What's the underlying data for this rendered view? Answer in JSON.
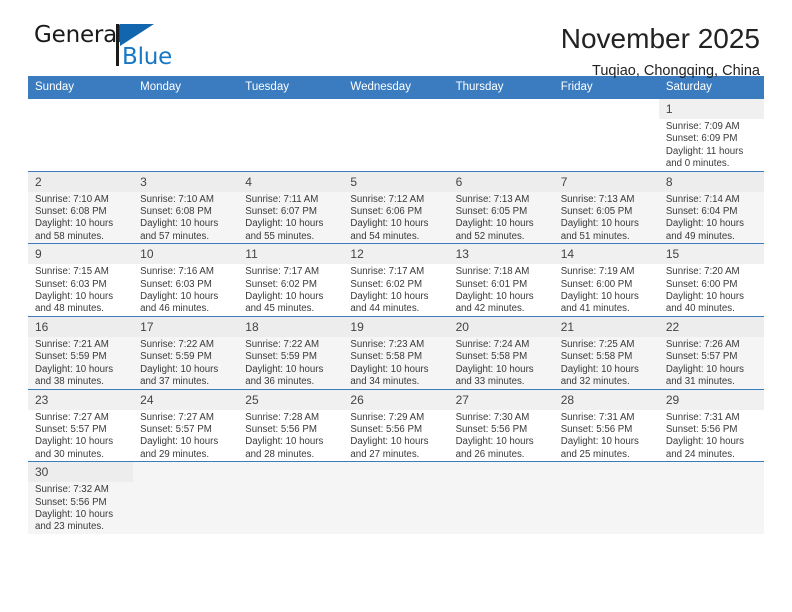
{
  "brand": {
    "name_top": "General",
    "name_bottom": "Blue",
    "colors": {
      "accent": "#1777c4",
      "flag": "#1266ad",
      "header": "#3b7cc0"
    }
  },
  "header": {
    "title": "November 2025",
    "subtitle": "Tuqiao, Chongqing, China"
  },
  "weekday_headers": [
    "Sunday",
    "Monday",
    "Tuesday",
    "Wednesday",
    "Thursday",
    "Friday",
    "Saturday"
  ],
  "weeks": [
    [
      {
        "empty": true
      },
      {
        "empty": true
      },
      {
        "empty": true
      },
      {
        "empty": true
      },
      {
        "empty": true
      },
      {
        "empty": true
      },
      {
        "day": "1",
        "sunrise": "Sunrise: 7:09 AM",
        "sunset": "Sunset: 6:09 PM",
        "daylight1": "Daylight: 11 hours",
        "daylight2": "and 0 minutes."
      }
    ],
    [
      {
        "day": "2",
        "sunrise": "Sunrise: 7:10 AM",
        "sunset": "Sunset: 6:08 PM",
        "daylight1": "Daylight: 10 hours",
        "daylight2": "and 58 minutes."
      },
      {
        "day": "3",
        "sunrise": "Sunrise: 7:10 AM",
        "sunset": "Sunset: 6:08 PM",
        "daylight1": "Daylight: 10 hours",
        "daylight2": "and 57 minutes."
      },
      {
        "day": "4",
        "sunrise": "Sunrise: 7:11 AM",
        "sunset": "Sunset: 6:07 PM",
        "daylight1": "Daylight: 10 hours",
        "daylight2": "and 55 minutes."
      },
      {
        "day": "5",
        "sunrise": "Sunrise: 7:12 AM",
        "sunset": "Sunset: 6:06 PM",
        "daylight1": "Daylight: 10 hours",
        "daylight2": "and 54 minutes."
      },
      {
        "day": "6",
        "sunrise": "Sunrise: 7:13 AM",
        "sunset": "Sunset: 6:05 PM",
        "daylight1": "Daylight: 10 hours",
        "daylight2": "and 52 minutes."
      },
      {
        "day": "7",
        "sunrise": "Sunrise: 7:13 AM",
        "sunset": "Sunset: 6:05 PM",
        "daylight1": "Daylight: 10 hours",
        "daylight2": "and 51 minutes."
      },
      {
        "day": "8",
        "sunrise": "Sunrise: 7:14 AM",
        "sunset": "Sunset: 6:04 PM",
        "daylight1": "Daylight: 10 hours",
        "daylight2": "and 49 minutes."
      }
    ],
    [
      {
        "day": "9",
        "sunrise": "Sunrise: 7:15 AM",
        "sunset": "Sunset: 6:03 PM",
        "daylight1": "Daylight: 10 hours",
        "daylight2": "and 48 minutes."
      },
      {
        "day": "10",
        "sunrise": "Sunrise: 7:16 AM",
        "sunset": "Sunset: 6:03 PM",
        "daylight1": "Daylight: 10 hours",
        "daylight2": "and 46 minutes."
      },
      {
        "day": "11",
        "sunrise": "Sunrise: 7:17 AM",
        "sunset": "Sunset: 6:02 PM",
        "daylight1": "Daylight: 10 hours",
        "daylight2": "and 45 minutes."
      },
      {
        "day": "12",
        "sunrise": "Sunrise: 7:17 AM",
        "sunset": "Sunset: 6:02 PM",
        "daylight1": "Daylight: 10 hours",
        "daylight2": "and 44 minutes."
      },
      {
        "day": "13",
        "sunrise": "Sunrise: 7:18 AM",
        "sunset": "Sunset: 6:01 PM",
        "daylight1": "Daylight: 10 hours",
        "daylight2": "and 42 minutes."
      },
      {
        "day": "14",
        "sunrise": "Sunrise: 7:19 AM",
        "sunset": "Sunset: 6:00 PM",
        "daylight1": "Daylight: 10 hours",
        "daylight2": "and 41 minutes."
      },
      {
        "day": "15",
        "sunrise": "Sunrise: 7:20 AM",
        "sunset": "Sunset: 6:00 PM",
        "daylight1": "Daylight: 10 hours",
        "daylight2": "and 40 minutes."
      }
    ],
    [
      {
        "day": "16",
        "sunrise": "Sunrise: 7:21 AM",
        "sunset": "Sunset: 5:59 PM",
        "daylight1": "Daylight: 10 hours",
        "daylight2": "and 38 minutes."
      },
      {
        "day": "17",
        "sunrise": "Sunrise: 7:22 AM",
        "sunset": "Sunset: 5:59 PM",
        "daylight1": "Daylight: 10 hours",
        "daylight2": "and 37 minutes."
      },
      {
        "day": "18",
        "sunrise": "Sunrise: 7:22 AM",
        "sunset": "Sunset: 5:59 PM",
        "daylight1": "Daylight: 10 hours",
        "daylight2": "and 36 minutes."
      },
      {
        "day": "19",
        "sunrise": "Sunrise: 7:23 AM",
        "sunset": "Sunset: 5:58 PM",
        "daylight1": "Daylight: 10 hours",
        "daylight2": "and 34 minutes."
      },
      {
        "day": "20",
        "sunrise": "Sunrise: 7:24 AM",
        "sunset": "Sunset: 5:58 PM",
        "daylight1": "Daylight: 10 hours",
        "daylight2": "and 33 minutes."
      },
      {
        "day": "21",
        "sunrise": "Sunrise: 7:25 AM",
        "sunset": "Sunset: 5:58 PM",
        "daylight1": "Daylight: 10 hours",
        "daylight2": "and 32 minutes."
      },
      {
        "day": "22",
        "sunrise": "Sunrise: 7:26 AM",
        "sunset": "Sunset: 5:57 PM",
        "daylight1": "Daylight: 10 hours",
        "daylight2": "and 31 minutes."
      }
    ],
    [
      {
        "day": "23",
        "sunrise": "Sunrise: 7:27 AM",
        "sunset": "Sunset: 5:57 PM",
        "daylight1": "Daylight: 10 hours",
        "daylight2": "and 30 minutes."
      },
      {
        "day": "24",
        "sunrise": "Sunrise: 7:27 AM",
        "sunset": "Sunset: 5:57 PM",
        "daylight1": "Daylight: 10 hours",
        "daylight2": "and 29 minutes."
      },
      {
        "day": "25",
        "sunrise": "Sunrise: 7:28 AM",
        "sunset": "Sunset: 5:56 PM",
        "daylight1": "Daylight: 10 hours",
        "daylight2": "and 28 minutes."
      },
      {
        "day": "26",
        "sunrise": "Sunrise: 7:29 AM",
        "sunset": "Sunset: 5:56 PM",
        "daylight1": "Daylight: 10 hours",
        "daylight2": "and 27 minutes."
      },
      {
        "day": "27",
        "sunrise": "Sunrise: 7:30 AM",
        "sunset": "Sunset: 5:56 PM",
        "daylight1": "Daylight: 10 hours",
        "daylight2": "and 26 minutes."
      },
      {
        "day": "28",
        "sunrise": "Sunrise: 7:31 AM",
        "sunset": "Sunset: 5:56 PM",
        "daylight1": "Daylight: 10 hours",
        "daylight2": "and 25 minutes."
      },
      {
        "day": "29",
        "sunrise": "Sunrise: 7:31 AM",
        "sunset": "Sunset: 5:56 PM",
        "daylight1": "Daylight: 10 hours",
        "daylight2": "and 24 minutes."
      }
    ],
    [
      {
        "day": "30",
        "sunrise": "Sunrise: 7:32 AM",
        "sunset": "Sunset: 5:56 PM",
        "daylight1": "Daylight: 10 hours",
        "daylight2": "and 23 minutes."
      },
      {
        "empty": true
      },
      {
        "empty": true
      },
      {
        "empty": true
      },
      {
        "empty": true
      },
      {
        "empty": true
      },
      {
        "empty": true
      }
    ]
  ]
}
